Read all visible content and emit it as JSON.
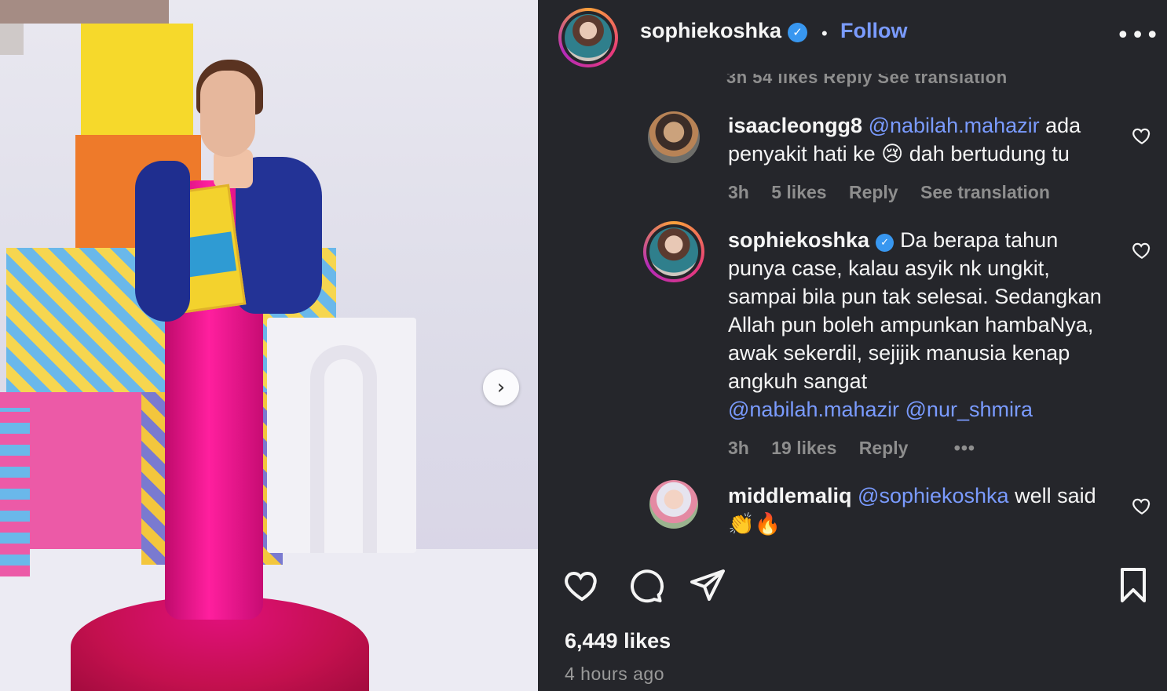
{
  "post": {
    "username": "sophiekoshka",
    "follow_label": "Follow",
    "header_separator": "•",
    "next_arrow": "›",
    "more_glyph": "•••"
  },
  "truncated_meta": "3h   54 likes   Reply   See translation",
  "comments": [
    {
      "username": "isaacleongg8",
      "mention": "@nabilah.mahazir",
      "text_after": " ada penyakit hati ke 😢 dah bertudung tu",
      "time": "3h",
      "likes": "5 likes",
      "reply": "Reply",
      "translation": "See translation"
    },
    {
      "username": "sophiekoshka",
      "text": "Da berapa tahun punya case, kalau asyik nk ungkit, sampai bila pun tak selesai. Sedangkan Allah pun boleh ampunkan hambaNya, awak sekerdil, sejijik manusia kenap angkuh sangat",
      "mentions": "@nabilah.mahazir @nur_shmira",
      "time": "3h",
      "likes": "19 likes",
      "reply": "Reply",
      "more": "•••"
    },
    {
      "username": "middlemaliq",
      "mention": "@sophiekoshka",
      "text_after": " well said👏🔥"
    }
  ],
  "footer": {
    "likes": "6,449 likes",
    "time": "4 hours ago"
  },
  "icons": {
    "like": "heart-icon",
    "comment": "comment-bubble-icon",
    "share": "paper-plane-icon",
    "save": "bookmark-icon",
    "verified": "verified-badge-icon",
    "next": "chevron-right-icon"
  },
  "colors": {
    "background": "#25262b",
    "link": "#7a9bff",
    "verified": "#3897f0",
    "muted": "#8e8e8e"
  }
}
